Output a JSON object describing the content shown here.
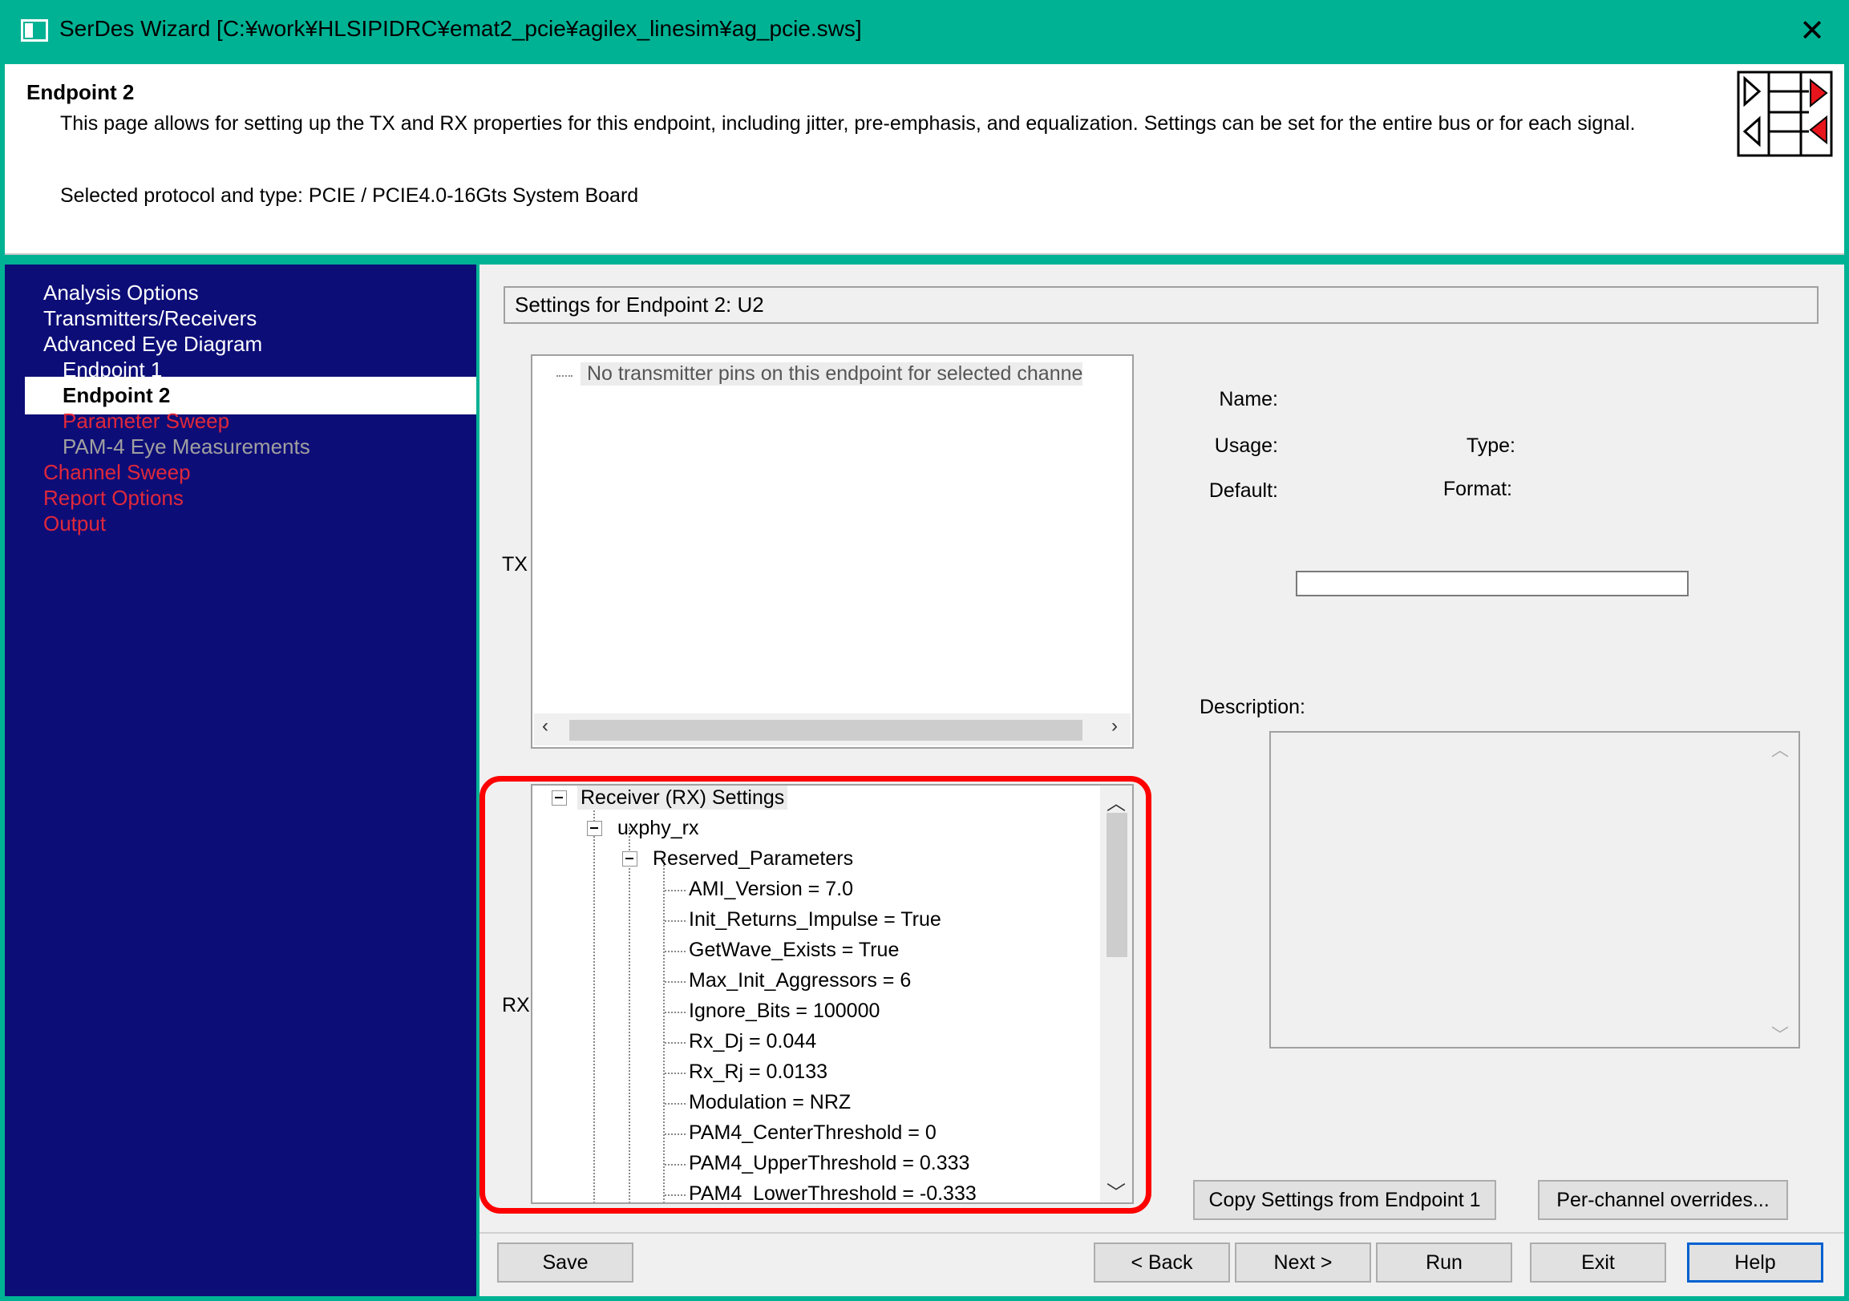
{
  "window": {
    "title": "SerDes Wizard [C:¥work¥HLSIPIDRC¥emat2_pcie¥agilex_linesim¥ag_pcie.sws]",
    "close_glyph": "✕",
    "icon": "app-window-icon"
  },
  "header": {
    "title": "Endpoint 2",
    "description": "This page allows for setting up the TX and RX properties for this endpoint, including jitter, pre-emphasis, and equalization.  Settings can be set for the entire bus or for each signal.",
    "protocol": "Selected protocol and type: PCIE / PCIE4.0-16Gts System Board",
    "logo": "tx-rx-endpoint-icon",
    "logo_accent": "#e8141c"
  },
  "nav": {
    "items": [
      {
        "label": "Analysis Options",
        "state": "normal"
      },
      {
        "label": "Transmitters/Receivers",
        "state": "normal"
      },
      {
        "label": "Advanced Eye Diagram",
        "state": "normal"
      },
      {
        "label": "Endpoint 1",
        "state": "normal"
      },
      {
        "label": "Endpoint 2",
        "state": "selected"
      },
      {
        "label": "Parameter Sweep",
        "state": "red"
      },
      {
        "label": "PAM-4 Eye Measurements",
        "state": "disabled"
      },
      {
        "label": "Channel Sweep",
        "state": "red"
      },
      {
        "label": "Report Options",
        "state": "red"
      },
      {
        "label": "Output",
        "state": "red"
      }
    ],
    "background": "#0d0d78",
    "link_color": "#e0283a"
  },
  "settings_title": "Settings for Endpoint 2: U2",
  "tx": {
    "label": "TX",
    "message": "No transmitter pins on this endpoint for selected channe",
    "scroll_left": "‹",
    "scroll_right": "›"
  },
  "rx": {
    "label": "RX",
    "root": "Receiver (RX) Settings",
    "model": "uxphy_rx",
    "group": "Reserved_Parameters",
    "params": [
      "AMI_Version = 7.0",
      "Init_Returns_Impulse = True",
      "GetWave_Exists = True",
      "Max_Init_Aggressors = 6",
      "Ignore_Bits = 100000",
      "Rx_Dj = 0.044",
      "Rx_Rj = 0.0133",
      "Modulation = NRZ",
      "PAM4_CenterThreshold = 0",
      "PAM4_UpperThreshold = 0.333",
      "PAM4_LowerThreshold = -0.333"
    ],
    "scroll_up": "︿",
    "scroll_down": "﹀",
    "highlight_color": "#ff0000"
  },
  "properties": {
    "name_label": "Name:",
    "usage_label": "Usage:",
    "type_label": "Type:",
    "default_label": "Default:",
    "format_label": "Format:",
    "value": "",
    "description_label": "Description:",
    "description_text": ""
  },
  "buttons": {
    "copy": "Copy Settings from Endpoint 1",
    "overrides": "Per-channel overrides...",
    "save": "Save",
    "back": "< Back",
    "next": "Next >",
    "run": "Run",
    "exit": "Exit",
    "help": "Help"
  }
}
